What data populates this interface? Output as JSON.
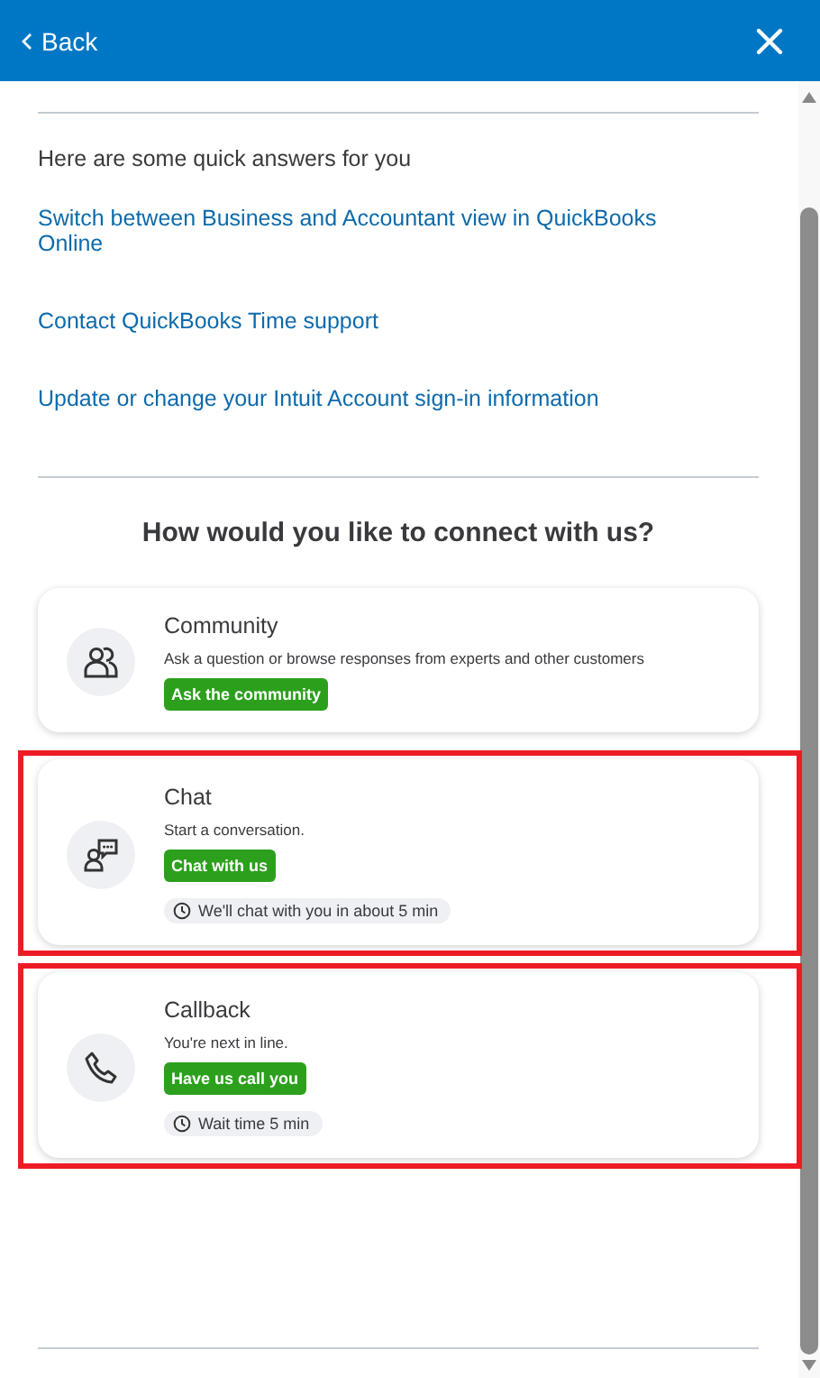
{
  "header": {
    "back_label": "Back"
  },
  "quick_answers": {
    "intro": "Here are some quick answers for you",
    "links": [
      "Switch between Business and Accountant view in QuickBooks Online",
      "Contact QuickBooks Time support",
      "Update or change your Intuit Account sign-in information"
    ]
  },
  "connect": {
    "heading": "How would you like to connect with us?",
    "options": [
      {
        "kind": "community",
        "title": "Community",
        "description": "Ask a question or browse responses from experts and other customers",
        "button": "Ask the community",
        "highlighted": false
      },
      {
        "kind": "chat",
        "title": "Chat",
        "description": "Start a conversation.",
        "button": "Chat with us",
        "wait": "We'll chat with you in about 5 min",
        "highlighted": true
      },
      {
        "kind": "callback",
        "title": "Callback",
        "description": "You're next in line.",
        "button": "Have us call you",
        "wait": "Wait time 5 min",
        "highlighted": true
      }
    ]
  }
}
